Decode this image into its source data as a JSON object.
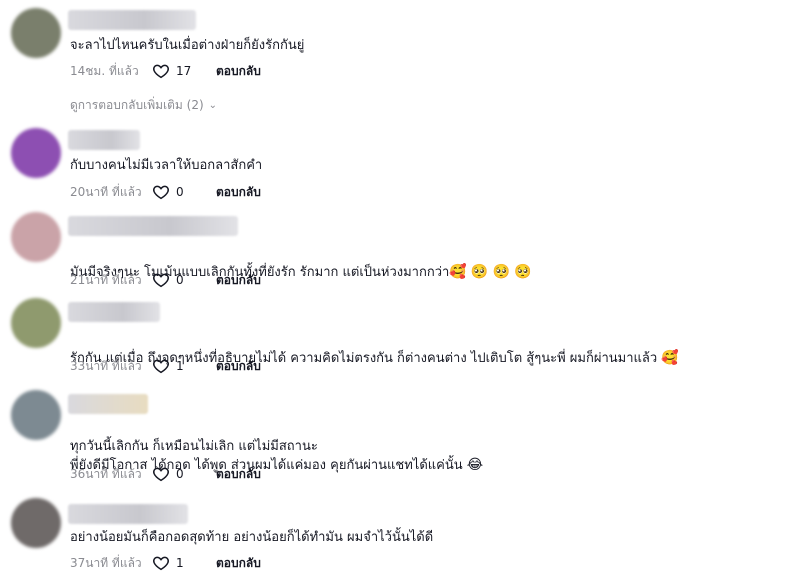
{
  "comments": [
    {
      "text": "จะลาไปไหนครับในเมื่อต่างฝ่ายก็ยังรักกันยู่",
      "time": "14ชม. ที่แล้ว",
      "likes": "17",
      "reply": "ตอบกลับ",
      "avatar_color": "#7a7f6c",
      "more_replies": "ดูการตอบกลับเพิ่มเติม (2)"
    },
    {
      "text": "กับบางคนไม่มีเวลาให้บอกลาสักคำ",
      "time": "20นาที ที่แล้ว",
      "likes": "0",
      "reply": "ตอบกลับ",
      "avatar_color": "#8d4fb2"
    },
    {
      "text": "มันมีจริงๆนะ โมเม้นแบบเลิกกันทั้งที่ยังรัก รักมาก แต่เป็นห่วงมากกว่า",
      "emojis": [
        "🥰",
        "🥺",
        "🥺",
        "🥺"
      ],
      "time": "21นาที ที่แล้ว",
      "likes": "0",
      "reply": "ตอบกลับ",
      "avatar_color": "#caa3a8"
    },
    {
      "text": "รักกัน แต่เมื่อ ถึงจุดๆหนึ่งที่อธิบายไม่ได้ ความคิดไม่ตรงกัน ก็ต่างคนต่าง ไปเติบโต สู้ๆนะพี่ ผมก็ผ่านมาแล้ว",
      "emojis": [
        "🥰"
      ],
      "time": "33นาที ที่แล้ว",
      "likes": "1",
      "reply": "ตอบกลับ",
      "avatar_color": "#8f9a6e"
    },
    {
      "text": "ทุกวันนี้เลิกกัน ก็เหมือนไม่เลิก แต่ไม่มีสถานะ\nพี่ยังดีมีโอกาส ได้กอด ได้พูด ส่วนผมได้แค่มอง คุยกันผ่านแชทได้แค่นั้น",
      "emojis": [
        "😂"
      ],
      "time": "36นาที ที่แล้ว",
      "likes": "0",
      "reply": "ตอบกลับ",
      "avatar_color": "#7d8a92"
    },
    {
      "text": "อย่างน้อยมันก็คือกอดสุดท้าย อย่างน้อยก็ได้ทำมัน ผมจำไว้นั้นได้ดี",
      "time": "37นาที ที่แล้ว",
      "likes": "1",
      "reply": "ตอบกลับ",
      "avatar_color": "#6f6a69"
    }
  ]
}
